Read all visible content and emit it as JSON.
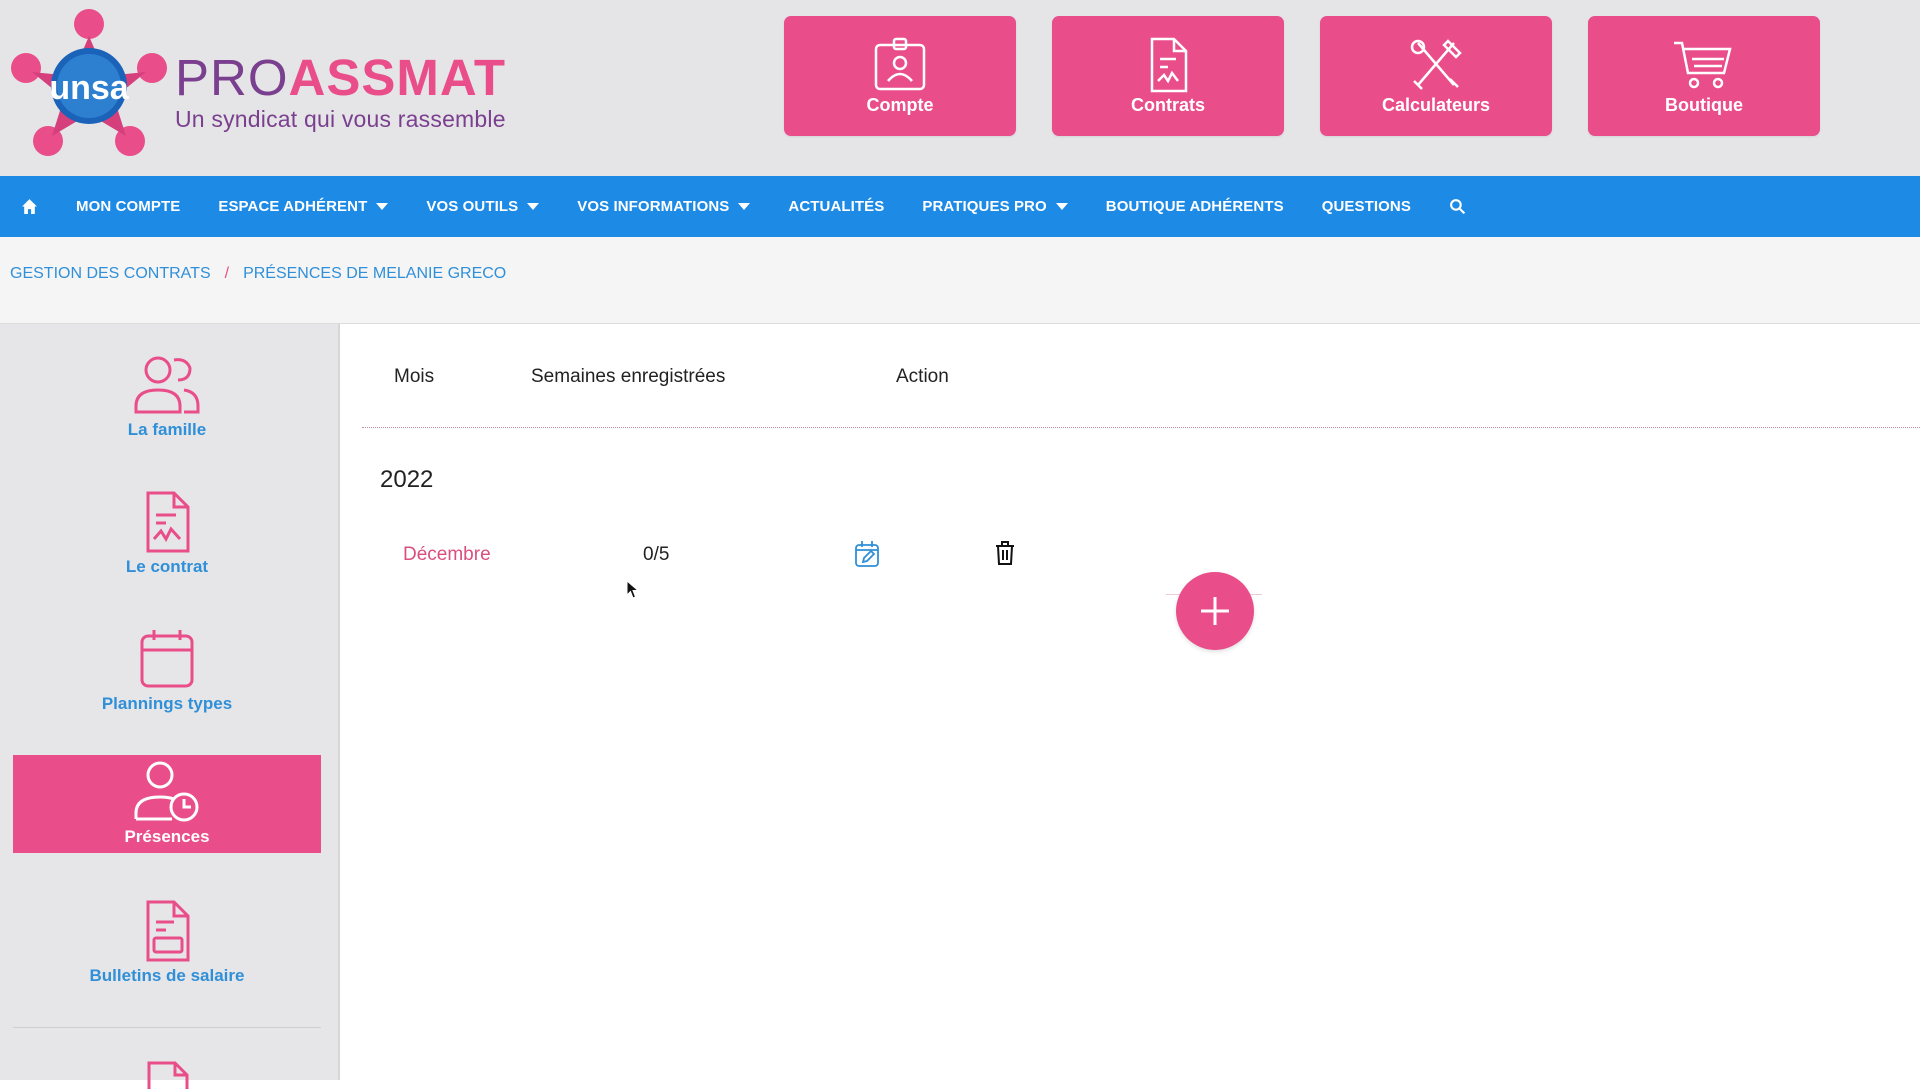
{
  "brand": {
    "logo_text": "unsa",
    "name_part1": "PRO",
    "name_part2": "ASSMAT",
    "tagline": "Un syndicat qui vous rassemble"
  },
  "top_tiles": [
    {
      "label": "Compte",
      "icon": "id-badge-icon"
    },
    {
      "label": "Contrats",
      "icon": "contract-document-icon"
    },
    {
      "label": "Calculateurs",
      "icon": "tools-icon"
    },
    {
      "label": "Boutique",
      "icon": "shopping-cart-icon"
    }
  ],
  "nav": {
    "home_icon": "home-icon",
    "items": [
      {
        "label": "MON COMPTE",
        "dropdown": false
      },
      {
        "label": "ESPACE ADHÉRENT",
        "dropdown": true
      },
      {
        "label": "VOS OUTILS",
        "dropdown": true
      },
      {
        "label": "VOS INFORMATIONS",
        "dropdown": true
      },
      {
        "label": "ACTUALITÉS",
        "dropdown": false
      },
      {
        "label": "PRATIQUES PRO",
        "dropdown": true
      },
      {
        "label": "BOUTIQUE ADHÉRENTS",
        "dropdown": false
      },
      {
        "label": "QUESTIONS",
        "dropdown": false
      }
    ],
    "search_icon": "search-icon"
  },
  "breadcrumb": {
    "items": [
      "GESTION DES CONTRATS",
      "PRÉSENCES DE MELANIE GRECO"
    ],
    "separator": "/"
  },
  "sidebar": {
    "items": [
      {
        "label": "La famille",
        "icon": "family-icon",
        "active": false
      },
      {
        "label": "Le contrat",
        "icon": "contract-icon",
        "active": false
      },
      {
        "label": "Plannings types",
        "icon": "calendar-icon",
        "active": false
      },
      {
        "label": "Présences",
        "icon": "user-clock-icon",
        "active": true
      },
      {
        "label": "Bulletins de salaire",
        "icon": "payslip-icon",
        "active": false
      }
    ]
  },
  "table": {
    "headers": [
      "Mois",
      "Semaines enregistrées",
      "Action"
    ],
    "groups": [
      {
        "year": "2022",
        "rows": [
          {
            "month": "Décembre",
            "weeks": "0/5",
            "actions": [
              "edit-calendar-icon",
              "trash-icon"
            ]
          }
        ]
      }
    ]
  },
  "colors": {
    "accent_pink": "#e94e8a",
    "nav_blue": "#1d8ae6",
    "link_blue": "#2f8fd8",
    "brand_purple": "#7a3f8e",
    "header_bg": "#e5e5e7"
  }
}
